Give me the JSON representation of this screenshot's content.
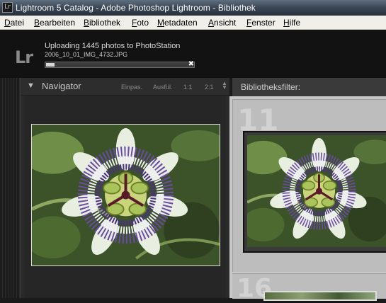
{
  "window": {
    "app_icon": "Lr",
    "title": "Lightroom 5 Catalog - Adobe Photoshop Lightroom - Bibliothek"
  },
  "menu": [
    {
      "key": "D",
      "rest": "atei"
    },
    {
      "key": "B",
      "rest": "earbeiten"
    },
    {
      "key": "B",
      "rest": "ibliothek"
    },
    {
      "key": "F",
      "rest": "oto"
    },
    {
      "key": "M",
      "rest": "etadaten"
    },
    {
      "key": "A",
      "rest": "nsicht"
    },
    {
      "key": "F",
      "rest": "enster"
    },
    {
      "key": "H",
      "rest": "ilfe"
    }
  ],
  "identity": {
    "logo": "Lr",
    "activity_title": "Uploading 1445 photos to PhotoStation",
    "activity_file": "2006_10_01_IMG_4732.JPG",
    "progress_fraction": 0.06,
    "cancel_glyph": "✖"
  },
  "navigator": {
    "triangle": "▼",
    "title": "Navigator",
    "zoom_options": [
      "Einpas.",
      "Ausfül.",
      "1:1",
      "2:1"
    ],
    "zoom_arrows": "▲▼"
  },
  "library": {
    "filter_label": "Bibliotheksfilter:",
    "cells": [
      {
        "number": "11"
      },
      {
        "number": "16"
      }
    ]
  },
  "icons": {
    "app": "lightroom-icon",
    "cancel": "close-icon",
    "collapse": "triangle-down-icon",
    "zoom_stepper": "up-down-arrows-icon"
  },
  "colors": {
    "titlebar": "#3d4957",
    "menubar": "#f1efe9",
    "panel": "#2a2a2a",
    "grid": "#c8c8c8"
  }
}
